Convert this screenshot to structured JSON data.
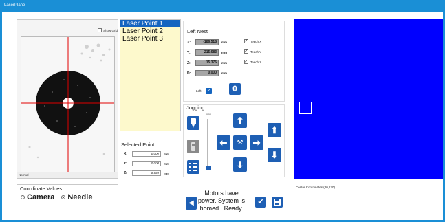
{
  "window": {
    "title": "LaserPlane"
  },
  "camera": {
    "show_grid_label": "Show Grid",
    "status": "Normal"
  },
  "laser_points": [
    {
      "label": "Laser Point 1",
      "selected": true
    },
    {
      "label": "Laser Point 2",
      "selected": false
    },
    {
      "label": "Laser Point 3",
      "selected": false
    }
  ],
  "selected_point": {
    "title": "Selected Point",
    "x_label": "X:",
    "x_value": "0.000",
    "y_label": "Y:",
    "y_value": "0.000",
    "z_label": "Z:",
    "z_value": "0.000",
    "unit": "mm"
  },
  "left_nest": {
    "title": "Left Nest",
    "x_label": "X:",
    "x_value": "-186.518",
    "y_label": "Y:",
    "y_value": "215.683",
    "z_label": "Z:",
    "z_value": "15.376",
    "d_label": "D:",
    "d_value": "0.000",
    "unit": "mm",
    "teach_x": "Teach X",
    "teach_y": "Teach Y",
    "teach_z": "Teach Z",
    "left_label": "Left",
    "left_checked": true
  },
  "jogging": {
    "title": "Jogging",
    "slider_tick": "0.04",
    "slider_level": 0.1
  },
  "center_coords": "Center Coordinates (20,170)",
  "coordinate_values": {
    "title": "Coordinate Values",
    "options": [
      "Camera",
      "Needle"
    ],
    "selected": "Needle"
  },
  "motor_status": "Motors have power. System is homed...Ready.",
  "colors": {
    "title_bar": "#1a8fd6",
    "button": "#1e5fb4",
    "view_background": "#0000ff",
    "list_background": "#fdf9cc"
  }
}
